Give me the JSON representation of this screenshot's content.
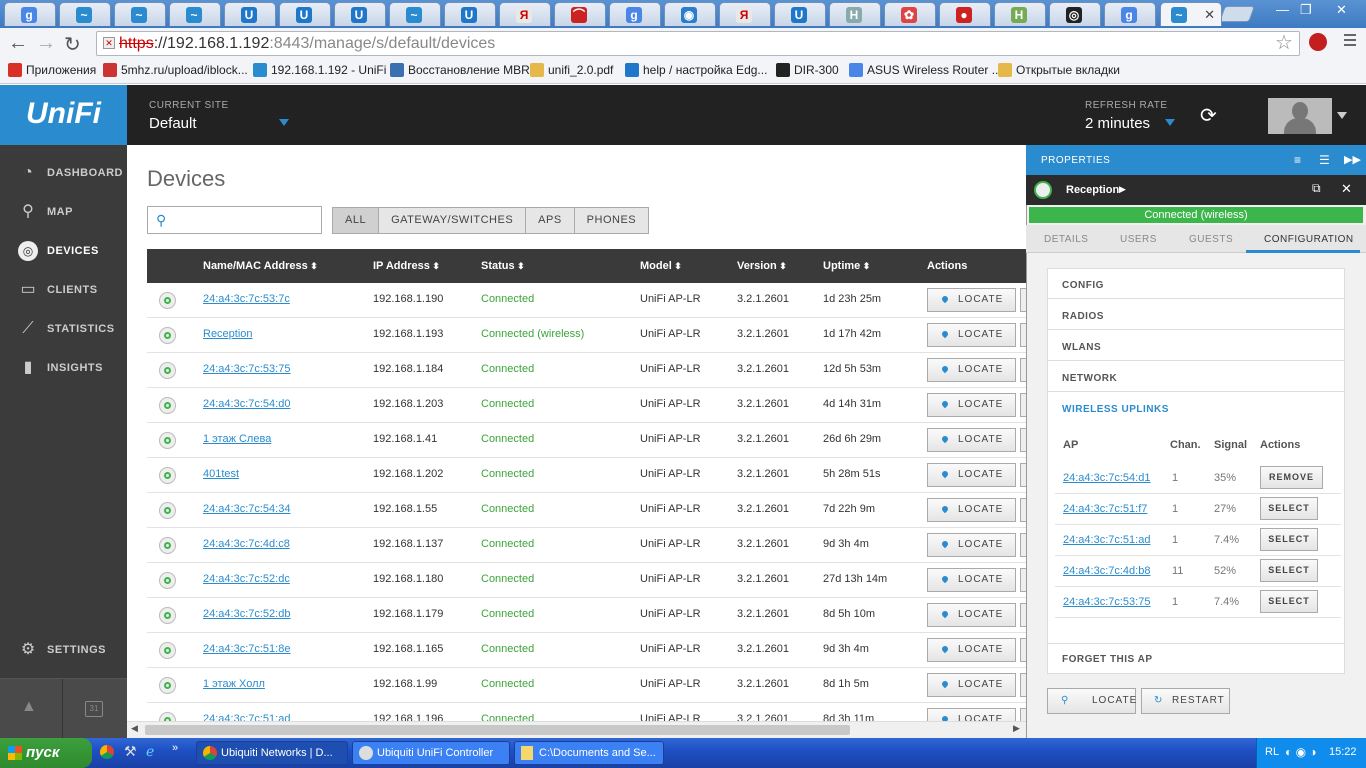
{
  "browser": {
    "tabs": [
      {
        "icon": "google-icon",
        "color": "#4a86e8",
        "glyph": "g"
      },
      {
        "icon": "ubnt-icon",
        "color": "#2a8ccf",
        "glyph": "~"
      },
      {
        "icon": "ubnt-icon",
        "color": "#2a8ccf",
        "glyph": "~"
      },
      {
        "icon": "ubnt-icon",
        "color": "#2a8ccf",
        "glyph": "~"
      },
      {
        "icon": "unifi-icon",
        "color": "#1f77c9",
        "glyph": "U"
      },
      {
        "icon": "unifi-icon",
        "color": "#1f77c9",
        "glyph": "U"
      },
      {
        "icon": "unifi-icon",
        "color": "#1f77c9",
        "glyph": "U"
      },
      {
        "icon": "ubnt-icon",
        "color": "#2a8ccf",
        "glyph": "~"
      },
      {
        "icon": "unifi-icon",
        "color": "#1f77c9",
        "glyph": "U"
      },
      {
        "icon": "yandex-icon",
        "color": "#e8e8e8",
        "glyph": "Я"
      },
      {
        "icon": "opera-icon",
        "color": "#cc2222",
        "glyph": "⌒"
      },
      {
        "icon": "google-icon",
        "color": "#4a86e8",
        "glyph": "g"
      },
      {
        "icon": "chat-icon",
        "color": "#2a7ccf",
        "glyph": "◉"
      },
      {
        "icon": "yandex-icon",
        "color": "#e8e8e8",
        "glyph": "Я"
      },
      {
        "icon": "unifi-icon",
        "color": "#1f77c9",
        "glyph": "U"
      },
      {
        "icon": "habr-icon",
        "color": "#8aa",
        "glyph": "H"
      },
      {
        "icon": "color-icon",
        "color": "#d44",
        "glyph": "✿"
      },
      {
        "icon": "red-icon",
        "color": "#c22",
        "glyph": "●"
      },
      {
        "icon": "green-icon",
        "color": "#7a5",
        "glyph": "H"
      },
      {
        "icon": "black-icon",
        "color": "#222",
        "glyph": "◎"
      },
      {
        "icon": "google-icon",
        "color": "#4a86e8",
        "glyph": "g"
      }
    ],
    "active_tab_close": "✕",
    "url_scheme": "https",
    "url_rest": "://192.168.1.192",
    "url_port": ":8443/manage/s/default/devices",
    "bookmarks": [
      {
        "label": "Приложения",
        "color": "#d93025"
      },
      {
        "label": "5mhz.ru/upload/iblock...",
        "color": "#c33"
      },
      {
        "label": "192.168.1.192 - UniFi",
        "color": "#2a8ccf"
      },
      {
        "label": "Восстановление MBR",
        "color": "#3a6fb0"
      },
      {
        "label": "unifi_2.0.pdf",
        "color": "#e6b84a"
      },
      {
        "label": "help / настройка Edg...",
        "color": "#1f77c9"
      },
      {
        "label": "DIR-300",
        "color": "#222"
      },
      {
        "label": "ASUS Wireless Router ...",
        "color": "#4a86e8"
      },
      {
        "label": "Открытые вкладки",
        "color": "#e6b84a"
      }
    ]
  },
  "header": {
    "logo": "UniFi",
    "current_site_label": "CURRENT SITE",
    "current_site": "Default",
    "refresh_label": "REFRESH RATE",
    "refresh_value": "2 minutes"
  },
  "nav": [
    {
      "id": "dashboard",
      "label": "DASHBOARD",
      "icon": "dashboard-icon",
      "glyph": "◔"
    },
    {
      "id": "map",
      "label": "MAP",
      "icon": "map-pin-icon",
      "glyph": "⚲"
    },
    {
      "id": "devices",
      "label": "DEVICES",
      "icon": "devices-icon",
      "glyph": "◎"
    },
    {
      "id": "clients",
      "label": "CLIENTS",
      "icon": "laptop-icon",
      "glyph": "▭"
    },
    {
      "id": "statistics",
      "label": "STATISTICS",
      "icon": "line-chart-icon",
      "glyph": "⟋"
    },
    {
      "id": "insights",
      "label": "INSIGHTS",
      "icon": "bar-chart-icon",
      "glyph": "▮"
    },
    {
      "id": "settings",
      "label": "SETTINGS",
      "icon": "gear-icon",
      "glyph": "⚙"
    }
  ],
  "nav_bottom": {
    "alerts": "▲",
    "calendar": "31"
  },
  "main": {
    "title": "Devices",
    "search_placeholder": "",
    "filters": [
      "ALL",
      "GATEWAY/SWITCHES",
      "APS",
      "PHONES"
    ],
    "columns": [
      "Name/MAC Address",
      "IP Address",
      "Status",
      "Model",
      "Version",
      "Uptime",
      "Actions"
    ],
    "locate_label": "LOCATE",
    "rows": [
      {
        "name": "24:a4:3c:7c:53:7c",
        "ip": "192.168.1.190",
        "status": "Connected",
        "model": "UniFi AP-LR",
        "version": "3.2.1.2601",
        "uptime": "1d 23h 25m"
      },
      {
        "name": "Reception",
        "ip": "192.168.1.193",
        "status": "Connected (wireless)",
        "model": "UniFi AP-LR",
        "version": "3.2.1.2601",
        "uptime": "1d 17h 42m"
      },
      {
        "name": "24:a4:3c:7c:53:75",
        "ip": "192.168.1.184",
        "status": "Connected",
        "model": "UniFi AP-LR",
        "version": "3.2.1.2601",
        "uptime": "12d 5h 53m"
      },
      {
        "name": "24:a4:3c:7c:54:d0",
        "ip": "192.168.1.203",
        "status": "Connected",
        "model": "UniFi AP-LR",
        "version": "3.2.1.2601",
        "uptime": "4d 14h 31m"
      },
      {
        "name": "1 этаж Слева",
        "ip": "192.168.1.41",
        "status": "Connected",
        "model": "UniFi AP-LR",
        "version": "3.2.1.2601",
        "uptime": "26d 6h 29m"
      },
      {
        "name": "401test",
        "ip": "192.168.1.202",
        "status": "Connected",
        "model": "UniFi AP-LR",
        "version": "3.2.1.2601",
        "uptime": "5h 28m 51s"
      },
      {
        "name": "24:a4:3c:7c:54:34",
        "ip": "192.168.1.55",
        "status": "Connected",
        "model": "UniFi AP-LR",
        "version": "3.2.1.2601",
        "uptime": "7d 22h 9m"
      },
      {
        "name": "24:a4:3c:7c:4d:c8",
        "ip": "192.168.1.137",
        "status": "Connected",
        "model": "UniFi AP-LR",
        "version": "3.2.1.2601",
        "uptime": "9d 3h 4m"
      },
      {
        "name": "24:a4:3c:7c:52:dc",
        "ip": "192.168.1.180",
        "status": "Connected",
        "model": "UniFi AP-LR",
        "version": "3.2.1.2601",
        "uptime": "27d 13h 14m"
      },
      {
        "name": "24:a4:3c:7c:52:db",
        "ip": "192.168.1.179",
        "status": "Connected",
        "model": "UniFi AP-LR",
        "version": "3.2.1.2601",
        "uptime": "8d 5h 10m"
      },
      {
        "name": "24:a4:3c:7c:51:8e",
        "ip": "192.168.1.165",
        "status": "Connected",
        "model": "UniFi AP-LR",
        "version": "3.2.1.2601",
        "uptime": "9d 3h 4m"
      },
      {
        "name": "1 этаж Холл",
        "ip": "192.168.1.99",
        "status": "Connected",
        "model": "UniFi AP-LR",
        "version": "3.2.1.2601",
        "uptime": "8d 1h 5m"
      },
      {
        "name": "24:a4:3c:7c:51:ad",
        "ip": "192.168.1.196",
        "status": "Connected",
        "model": "UniFi AP-LR",
        "version": "3.2.1.2601",
        "uptime": "8d 3h 11m"
      }
    ]
  },
  "panel": {
    "title": "PROPERTIES",
    "device": "Reception",
    "conn_status": "Connected (wireless)",
    "tabs": [
      "DETAILS",
      "USERS",
      "GUESTS",
      "CONFIGURATION"
    ],
    "sections": [
      "CONFIG",
      "RADIOS",
      "WLANS",
      "NETWORK",
      "WIRELESS UPLINKS"
    ],
    "uplink_cols": [
      "AP",
      "Chan.",
      "Signal",
      "Actions"
    ],
    "uplinks": [
      {
        "ap": "24:a4:3c:7c:54:d1",
        "chan": "1",
        "signal": "35%",
        "action": "REMOVE"
      },
      {
        "ap": "24:a4:3c:7c:51:f7",
        "chan": "1",
        "signal": "27%",
        "action": "SELECT"
      },
      {
        "ap": "24:a4:3c:7c:51:ad",
        "chan": "1",
        "signal": "7.4%",
        "action": "SELECT"
      },
      {
        "ap": "24:a4:3c:7c:4d:b8",
        "chan": "11",
        "signal": "52%",
        "action": "SELECT"
      },
      {
        "ap": "24:a4:3c:7c:53:75",
        "chan": "1",
        "signal": "7.4%",
        "action": "SELECT"
      }
    ],
    "forget": "FORGET THIS AP",
    "locate": "LOCATE",
    "restart": "RESTART"
  },
  "taskbar": {
    "start": "пуск",
    "windows": [
      "Ubiquiti Networks | D...",
      "Ubiquiti UniFi Controller",
      "C:\\Documents and Se..."
    ],
    "lang": "RL",
    "clock": "15:22"
  }
}
